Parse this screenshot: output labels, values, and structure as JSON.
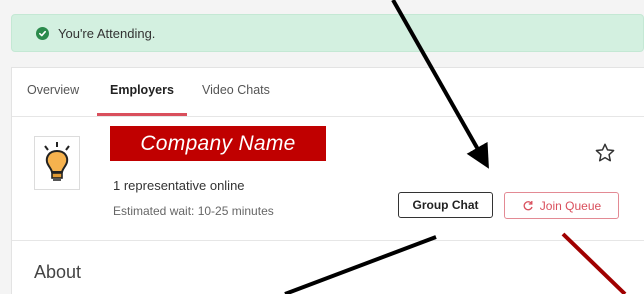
{
  "banner": {
    "text": "You're Attending."
  },
  "tabs": [
    {
      "label": "Overview"
    },
    {
      "label": "Employers"
    },
    {
      "label": "Video Chats"
    }
  ],
  "company": {
    "name": "Company Name",
    "representatives": "1 representative online",
    "wait": "Estimated wait: 10-25 minutes"
  },
  "actions": {
    "group_chat": "Group Chat",
    "join_queue": "Join Queue"
  },
  "section": {
    "about": "About"
  },
  "icons": {
    "banner": "check-circle-icon",
    "logo": "lightbulb-icon",
    "favorite": "star-outline-icon",
    "queue": "refresh-icon"
  },
  "colors": {
    "banner_bg": "#d3f0e0",
    "check_green": "#2b8a4c",
    "accent_red": "#d94f5c",
    "company_label_bg": "#c00000",
    "bulb_fill": "#f6b24e"
  }
}
